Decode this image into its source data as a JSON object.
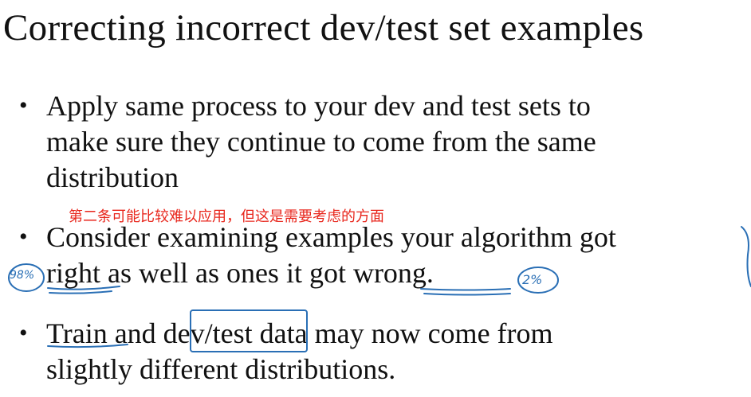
{
  "slide": {
    "title": "Correcting incorrect dev/test set examples",
    "bullets": [
      {
        "lines": [
          "Apply same process to your dev and test sets to",
          "make sure they continue to come from the same",
          "distribution"
        ]
      },
      {
        "lines": [
          "Consider examining examples your algorithm got",
          "right as well as ones it got wrong."
        ]
      },
      {
        "lines": [
          "Train and dev/test data may now come from",
          "slightly different distributions."
        ]
      }
    ],
    "bullet_symbol": "•",
    "subtitle_note": "第二条可能比较难以应用，但这是需要考虑的方面",
    "handwritten": {
      "left_circle": "98%",
      "right_circle": "2%"
    },
    "colors": {
      "note": "#e8261c",
      "ink": "#2a6fb5"
    }
  }
}
